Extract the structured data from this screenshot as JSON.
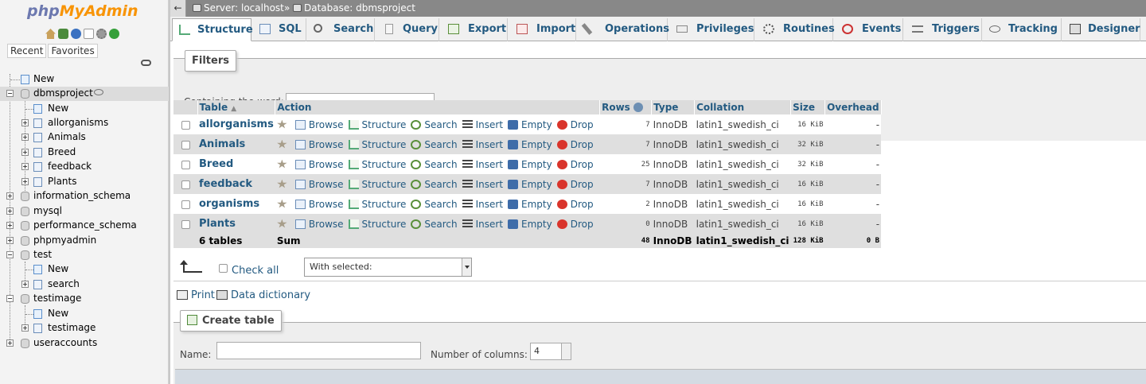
{
  "logo": {
    "php": "php",
    "myadmin": "MyAdmin"
  },
  "nav_tabs": {
    "recent": "Recent",
    "favorites": "Favorites"
  },
  "tree": {
    "new": "New",
    "dbmsproject": "dbmsproject",
    "db_new": "New",
    "tables": [
      "allorganisms",
      "Animals",
      "Breed",
      "feedback",
      "Plants"
    ],
    "information_schema": "information_schema",
    "mysql": "mysql",
    "performance_schema": "performance_schema",
    "phpmyadmin": "phpmyadmin",
    "test": "test",
    "test_new": "New",
    "test_search": "search",
    "testimage": "testimage",
    "testimage_new": "New",
    "testimage_table": "testimage",
    "useraccounts": "useraccounts"
  },
  "breadcrumb": {
    "server": "Server: localhost",
    "sep": "»",
    "database": "Database: dbmsproject"
  },
  "tabs": [
    "Structure",
    "SQL",
    "Search",
    "Query",
    "Export",
    "Import",
    "Operations",
    "Privileges",
    "Routines",
    "Events",
    "Triggers",
    "Tracking",
    "Designer"
  ],
  "filters": {
    "legend": "Filters",
    "label": "Containing the word:",
    "value": ""
  },
  "table_headers": {
    "table": "Table",
    "action": "Action",
    "rows": "Rows",
    "type": "Type",
    "collation": "Collation",
    "size": "Size",
    "overhead": "Overhead"
  },
  "actions": {
    "browse": "Browse",
    "structure": "Structure",
    "search": "Search",
    "insert": "Insert",
    "empty": "Empty",
    "drop": "Drop"
  },
  "rows": [
    {
      "name": "allorganisms",
      "rows": "7",
      "type": "InnoDB",
      "collation": "latin1_swedish_ci",
      "size": "16 KiB",
      "overhead": "-"
    },
    {
      "name": "Animals",
      "rows": "7",
      "type": "InnoDB",
      "collation": "latin1_swedish_ci",
      "size": "32 KiB",
      "overhead": "-"
    },
    {
      "name": "Breed",
      "rows": "25",
      "type": "InnoDB",
      "collation": "latin1_swedish_ci",
      "size": "32 KiB",
      "overhead": "-"
    },
    {
      "name": "feedback",
      "rows": "7",
      "type": "InnoDB",
      "collation": "latin1_swedish_ci",
      "size": "16 KiB",
      "overhead": "-"
    },
    {
      "name": "organisms",
      "rows": "2",
      "type": "InnoDB",
      "collation": "latin1_swedish_ci",
      "size": "16 KiB",
      "overhead": "-"
    },
    {
      "name": "Plants",
      "rows": "0",
      "type": "InnoDB",
      "collation": "latin1_swedish_ci",
      "size": "16 KiB",
      "overhead": "-"
    }
  ],
  "summary": {
    "count": "6 tables",
    "label": "Sum",
    "rows": "48",
    "type": "InnoDB",
    "collation": "latin1_swedish_ci",
    "size": "128 KiB",
    "overhead": "0 B"
  },
  "footer": {
    "check_all": "Check all",
    "with_selected": "With selected:"
  },
  "links": {
    "print": "Print",
    "dictionary": "Data dictionary"
  },
  "create": {
    "legend": "Create table",
    "name_label": "Name:",
    "name_value": "",
    "cols_label": "Number of columns:",
    "cols_value": "4"
  },
  "colors": {
    "link": "#235a81",
    "topbar": "#888888",
    "row_alt": "#dfdfdf"
  }
}
